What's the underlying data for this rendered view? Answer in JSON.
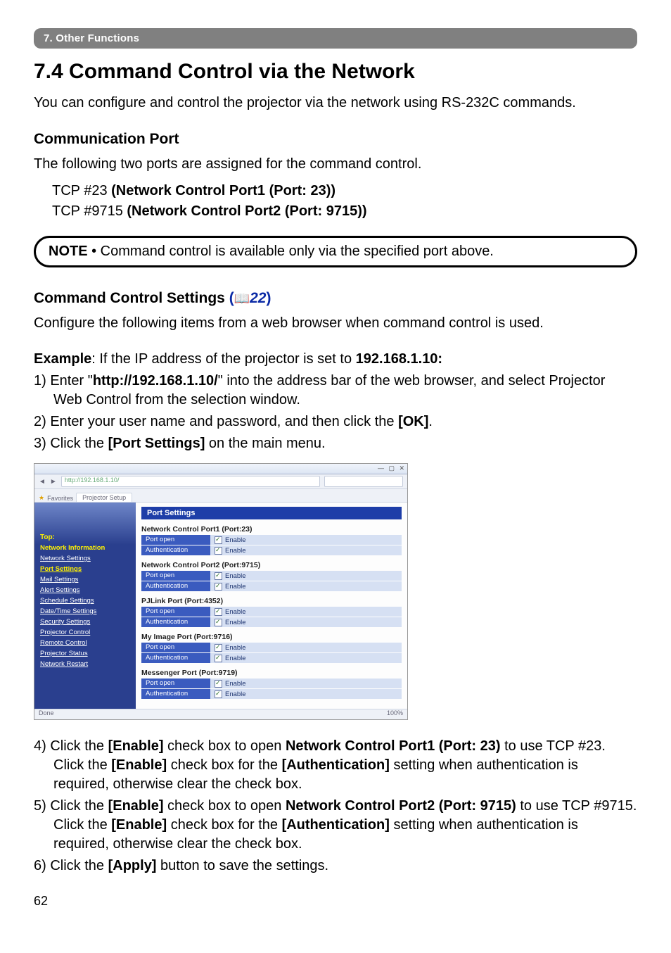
{
  "chapter_bar": "7. Other Functions",
  "section_title": "7.4 Command Control via the Network",
  "intro_text": "You can configure and control the projector via the network using RS-232C commands.",
  "comm_port_head": "Communication Port",
  "comm_port_text": "The following two ports are assigned for the command control.",
  "port1_line": {
    "prefix": "TCP #23 ",
    "bold": "(Network Control Port1 (Port: 23))"
  },
  "port2_line": {
    "prefix": "TCP #9715 ",
    "bold": "(Network Control Port2 (Port: 9715))"
  },
  "note_label": "NOTE",
  "note_text": "  • Command control is available only via the specified port above.",
  "cmd_ctrl_head": "Command Control Settings",
  "cmd_ctrl_ref": "22",
  "cfg_text": "Configure the following items from a web browser when command control is used.",
  "example_label": "Example",
  "example_rest": ": If the IP address of the projector is set to ",
  "example_ip": "192.168.1.10:",
  "step1a": "1) Enter \"",
  "step1url": "http://192.168.1.10/",
  "step1b": "\" into the address bar of the web browser, and select Projector Web Control from the selection window.",
  "step2a": "2) Enter your user name and password, and then click the ",
  "step2b": "[OK]",
  "step2c": ".",
  "step3a": "3) Click the ",
  "step3b": "[Port Settings]",
  "step3c": " on the main menu.",
  "step4a": "4) Click the ",
  "step4b": "[Enable]",
  "step4c": " check box to open ",
  "step4d": "Network Control Port1 (Port: 23)",
  "step4e": " to use TCP #23. Click the ",
  "step4f": "[Enable]",
  "step4g": " check box for the ",
  "step4h": "[Authentication]",
  "step4i": " setting when authentication is required, otherwise clear the check box.",
  "step5a": "5) Click the ",
  "step5b": "[Enable]",
  "step5c": " check box to open ",
  "step5d": "Network Control Port2 (Port: 9715)",
  "step5e": " to use TCP #9715. Click the ",
  "step5f": "[Enable]",
  "step5g": " check box for the ",
  "step5h": "[Authentication]",
  "step5i": " setting when authentication is required, otherwise clear the check box.",
  "step6a": "6) Click the ",
  "step6b": "[Apply]",
  "step6c": " button to save the settings.",
  "page_num": "62",
  "screenshot": {
    "addr_url": "http://192.168.1.10/",
    "tab_fav": "Favorites",
    "tab_name": "Projector Setup",
    "panel_title": "Port Settings",
    "side": {
      "top": "Top:",
      "items": [
        {
          "label": "Network Information",
          "active": true
        },
        {
          "label": "Network Settings"
        },
        {
          "label": "Port Settings",
          "active": true
        },
        {
          "label": "Mail Settings"
        },
        {
          "label": "Alert Settings"
        },
        {
          "label": "Schedule Settings"
        },
        {
          "label": "Date/Time Settings"
        },
        {
          "label": "Security Settings"
        },
        {
          "label": "Projector Control"
        },
        {
          "label": "Remote Control"
        },
        {
          "label": "Projector Status"
        },
        {
          "label": "Network Restart"
        }
      ]
    },
    "groups": [
      {
        "head": "Network Control Port1 (Port:23)",
        "rows": [
          {
            "label": "Port open",
            "val": "Enable"
          },
          {
            "label": "Authentication",
            "val": "Enable"
          }
        ]
      },
      {
        "head": "Network Control Port2 (Port:9715)",
        "rows": [
          {
            "label": "Port open",
            "val": "Enable"
          },
          {
            "label": "Authentication",
            "val": "Enable"
          }
        ]
      },
      {
        "head": "PJLink Port (Port:4352)",
        "rows": [
          {
            "label": "Port open",
            "val": "Enable"
          },
          {
            "label": "Authentication",
            "val": "Enable"
          }
        ]
      },
      {
        "head": "My Image Port (Port:9716)",
        "rows": [
          {
            "label": "Port open",
            "val": "Enable"
          },
          {
            "label": "Authentication",
            "val": "Enable"
          }
        ]
      },
      {
        "head": "Messenger Port (Port:9719)",
        "rows": [
          {
            "label": "Port open",
            "val": "Enable"
          },
          {
            "label": "Authentication",
            "val": "Enable"
          }
        ]
      }
    ],
    "status_left": "Done",
    "status_right": "100%"
  }
}
